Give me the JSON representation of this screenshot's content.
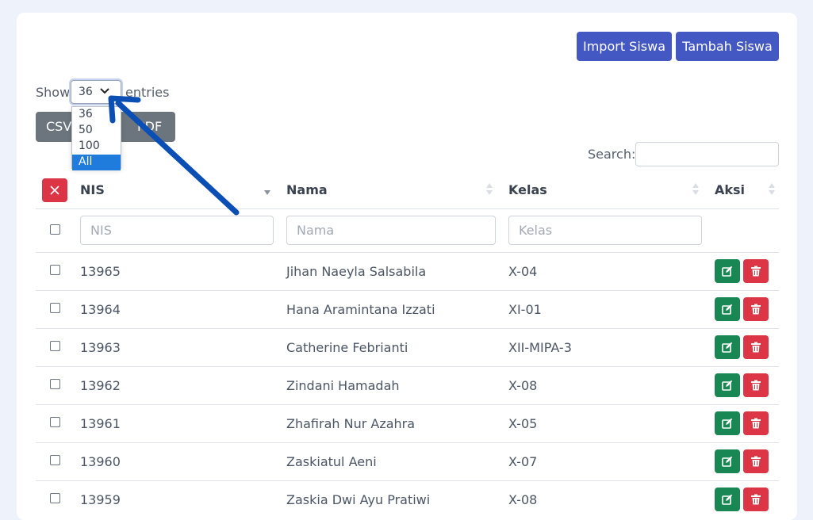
{
  "toolbar": {
    "import_label": "Import Siswa",
    "tambah_label": "Tambah Siswa"
  },
  "length": {
    "show_label": "Show",
    "entries_label": "entries",
    "selected": "36",
    "options": [
      "36",
      "50",
      "100",
      "All"
    ],
    "highlighted": "All"
  },
  "export": {
    "csv_label": "CSV",
    "pdf_label": "PDF"
  },
  "search": {
    "label": "Search:",
    "value": ""
  },
  "table": {
    "headers": {
      "nis": "NIS",
      "nama": "Nama",
      "kelas": "Kelas",
      "aksi": "Aksi"
    },
    "filters": {
      "nis": "NIS",
      "nama": "Nama",
      "kelas": "Kelas"
    },
    "rows": [
      {
        "nis": "13965",
        "nama": "Jihan Naeyla Salsabila",
        "kelas": "X-04"
      },
      {
        "nis": "13964",
        "nama": "Hana Aramintana Izzati",
        "kelas": "XI-01"
      },
      {
        "nis": "13963",
        "nama": "Catherine Febrianti",
        "kelas": "XII-MIPA-3"
      },
      {
        "nis": "13962",
        "nama": "Zindani Hamadah",
        "kelas": "X-08"
      },
      {
        "nis": "13961",
        "nama": "Zhafirah Nur Azahra",
        "kelas": "X-05"
      },
      {
        "nis": "13960",
        "nama": "Zaskiatul Aeni",
        "kelas": "X-07"
      },
      {
        "nis": "13959",
        "nama": "Zaskia Dwi Ayu Pratiwi",
        "kelas": "X-08"
      }
    ]
  },
  "colors": {
    "primary": "#4458c3",
    "danger": "#dc3545",
    "success": "#198754",
    "arrow": "#0b4fb5"
  }
}
